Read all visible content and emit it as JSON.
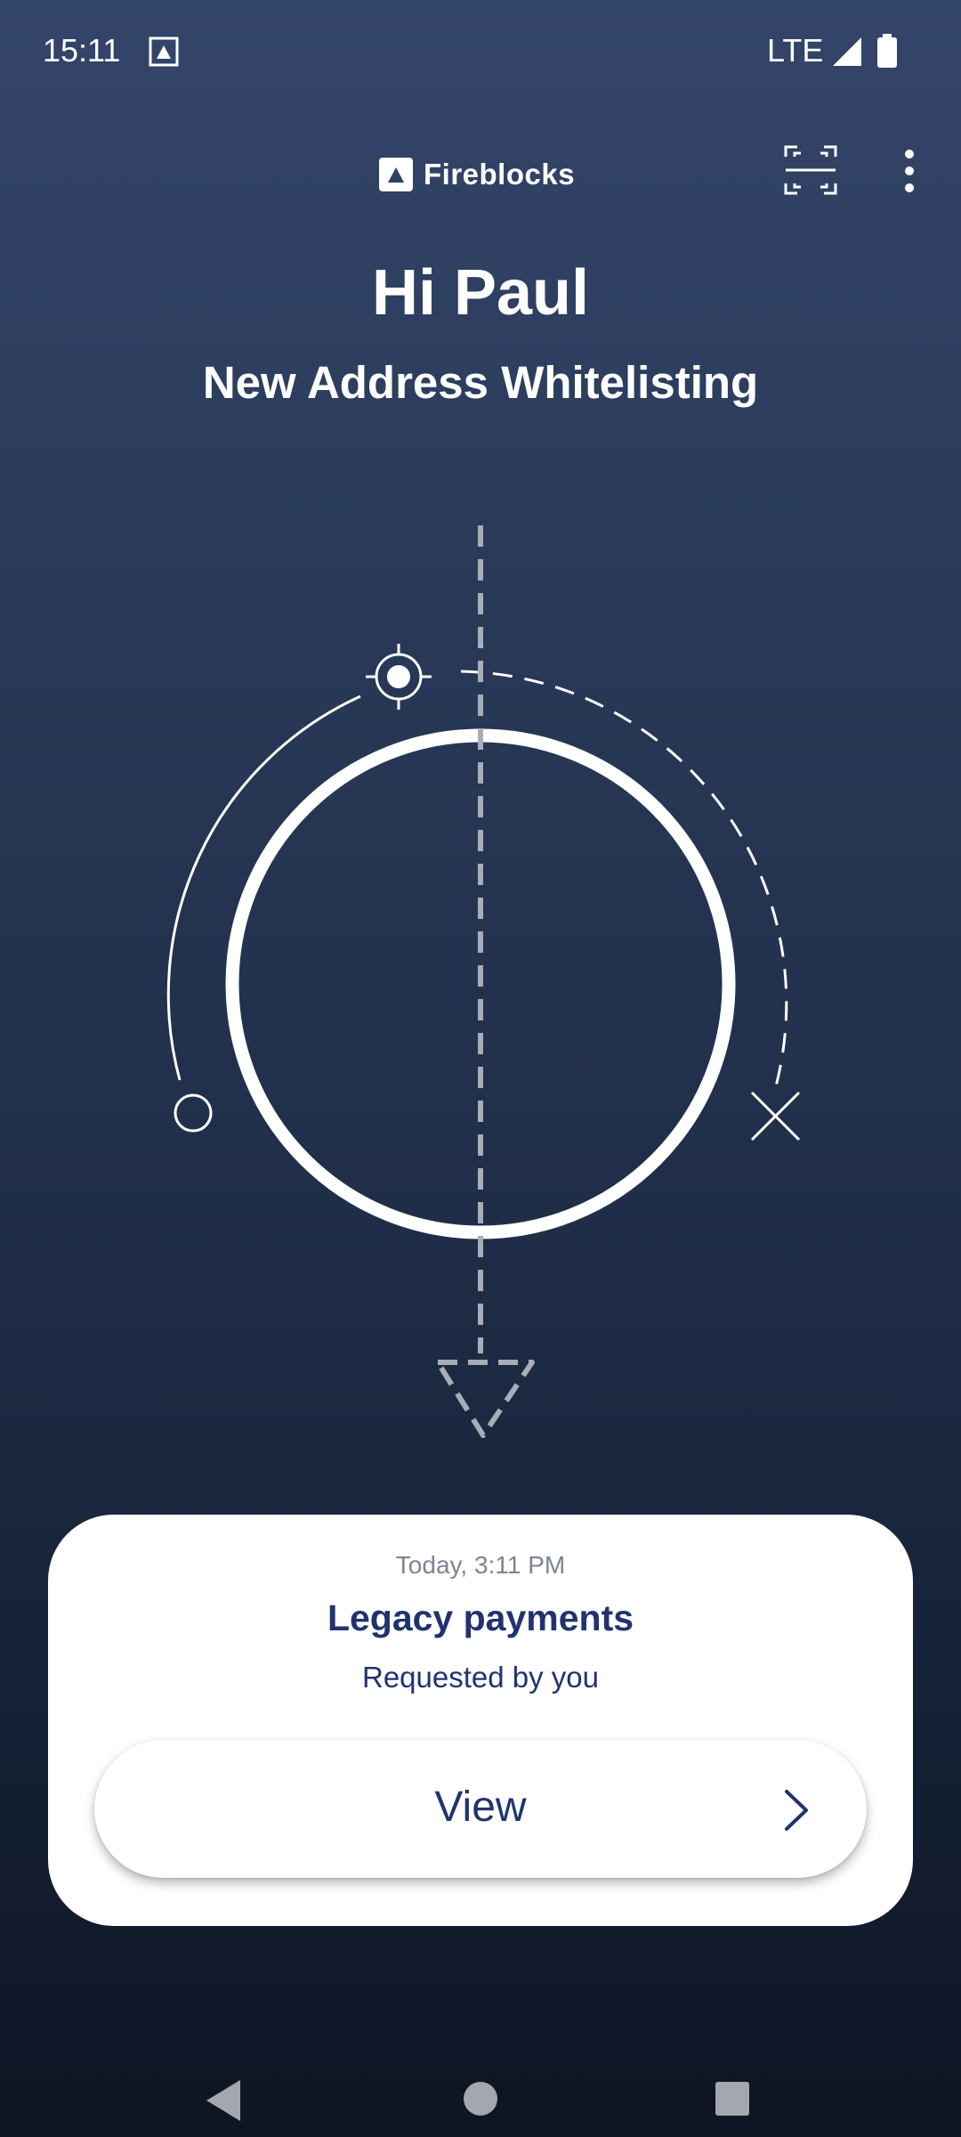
{
  "status_bar": {
    "time": "15:11",
    "network": "LTE",
    "icons": [
      "picture-icon",
      "signal-icon",
      "battery-icon"
    ]
  },
  "header": {
    "brand": "Fireblocks",
    "icons": [
      "fireblocks-logo-icon",
      "scan-icon",
      "more-vert-icon"
    ]
  },
  "greeting": "Hi Paul",
  "subtitle": "New Address Whitelisting",
  "request_card": {
    "date": "Today, 3:11 PM",
    "title": "Legacy payments",
    "requested_by": "Requested by you",
    "view_button": "View"
  },
  "colors": {
    "background_top": "#34456a",
    "background_bottom": "#0d1524",
    "card": "#ffffff",
    "accent_text": "#21336f",
    "muted_text": "#7d8491"
  },
  "nav_bar": {
    "icons": [
      "back-icon",
      "home-icon",
      "recents-icon"
    ]
  }
}
